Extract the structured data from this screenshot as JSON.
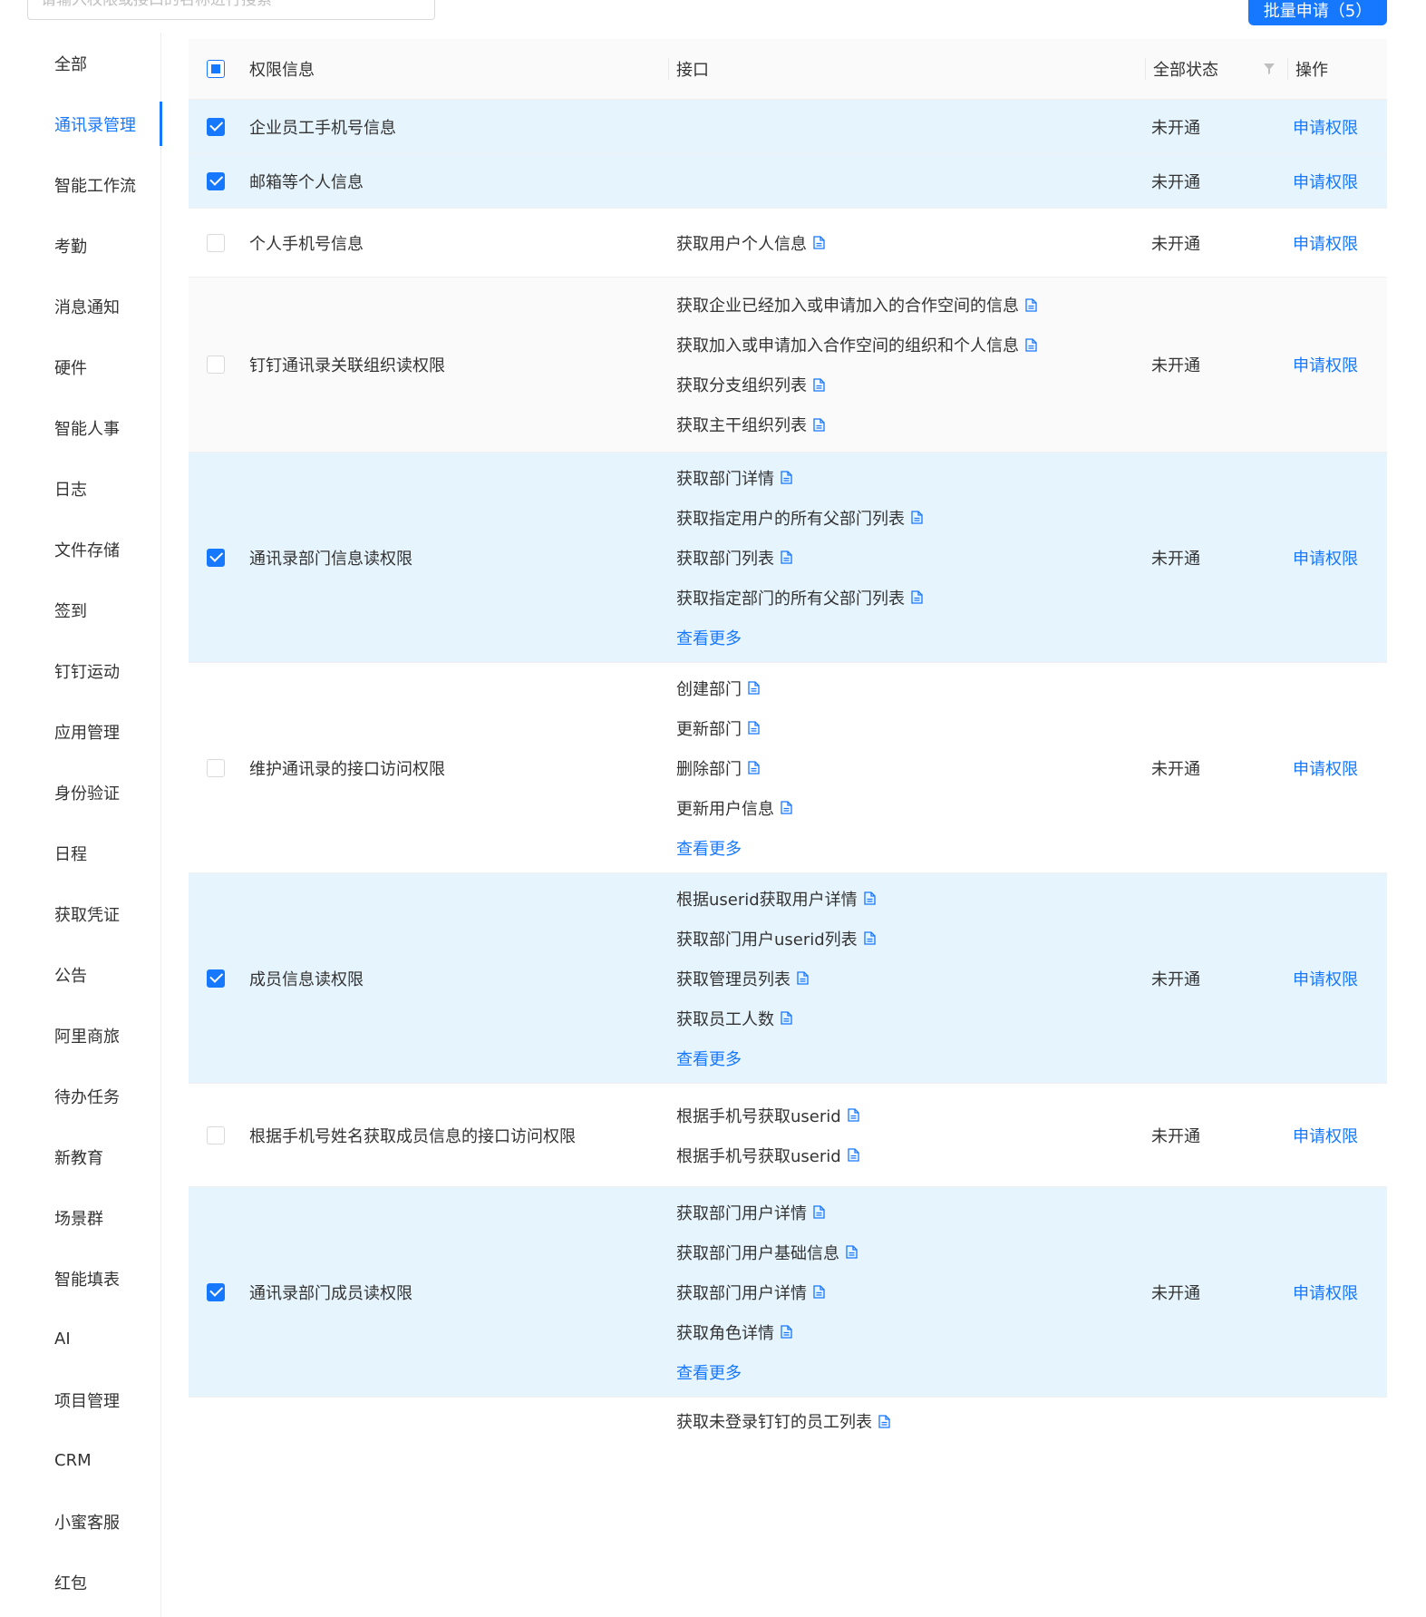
{
  "search": {
    "placeholder": "请输入权限或接口的名称进行搜索"
  },
  "batch_button": {
    "label": "批量申请（5）"
  },
  "sidebar": {
    "items": [
      {
        "label": "全部",
        "active": false
      },
      {
        "label": "通讯录管理",
        "active": true
      },
      {
        "label": "智能工作流",
        "active": false
      },
      {
        "label": "考勤",
        "active": false
      },
      {
        "label": "消息通知",
        "active": false
      },
      {
        "label": "硬件",
        "active": false
      },
      {
        "label": "智能人事",
        "active": false
      },
      {
        "label": "日志",
        "active": false
      },
      {
        "label": "文件存储",
        "active": false
      },
      {
        "label": "签到",
        "active": false
      },
      {
        "label": "钉钉运动",
        "active": false
      },
      {
        "label": "应用管理",
        "active": false
      },
      {
        "label": "身份验证",
        "active": false
      },
      {
        "label": "日程",
        "active": false
      },
      {
        "label": "获取凭证",
        "active": false
      },
      {
        "label": "公告",
        "active": false
      },
      {
        "label": "阿里商旅",
        "active": false
      },
      {
        "label": "待办任务",
        "active": false
      },
      {
        "label": "新教育",
        "active": false
      },
      {
        "label": "场景群",
        "active": false
      },
      {
        "label": "智能填表",
        "active": false
      },
      {
        "label": "AI",
        "active": false
      },
      {
        "label": "项目管理",
        "active": false
      },
      {
        "label": "CRM",
        "active": false
      },
      {
        "label": "小蜜客服",
        "active": false
      },
      {
        "label": "红包",
        "active": false
      }
    ]
  },
  "table": {
    "headers": {
      "perm": "权限信息",
      "api": "接口",
      "status": "全部状态",
      "op": "操作"
    },
    "rows": [
      {
        "name": "企业员工手机号信息",
        "checked": true,
        "apis": [],
        "more": "",
        "status": "未开通",
        "action": "申请权限"
      },
      {
        "name": "邮箱等个人信息",
        "checked": true,
        "apis": [],
        "more": "",
        "status": "未开通",
        "action": "申请权限"
      },
      {
        "name": "个人手机号信息",
        "checked": false,
        "apis": [
          "获取用户个人信息"
        ],
        "more": "",
        "status": "未开通",
        "action": "申请权限"
      },
      {
        "name": "钉钉通讯录关联组织读权限",
        "checked": false,
        "apis": [
          "获取企业已经加入或申请加入的合作空间的信息",
          "获取加入或申请加入合作空间的组织和个人信息",
          "获取分支组织列表",
          "获取主干组织列表"
        ],
        "more": "",
        "status": "未开通",
        "action": "申请权限"
      },
      {
        "name": "通讯录部门信息读权限",
        "checked": true,
        "apis": [
          "获取部门详情",
          "获取指定用户的所有父部门列表",
          "获取部门列表",
          "获取指定部门的所有父部门列表"
        ],
        "more": "查看更多",
        "status": "未开通",
        "action": "申请权限"
      },
      {
        "name": "维护通讯录的接口访问权限",
        "checked": false,
        "apis": [
          "创建部门",
          "更新部门",
          "删除部门",
          "更新用户信息"
        ],
        "more": "查看更多",
        "status": "未开通",
        "action": "申请权限"
      },
      {
        "name": "成员信息读权限",
        "checked": true,
        "apis": [
          "根据userid获取用户详情",
          "获取部门用户userid列表",
          "获取管理员列表",
          "获取员工人数"
        ],
        "more": "查看更多",
        "status": "未开通",
        "action": "申请权限"
      },
      {
        "name": "根据手机号姓名获取成员信息的接口访问权限",
        "checked": false,
        "apis": [
          "根据手机号获取userid",
          "根据手机号获取userid"
        ],
        "more": "",
        "status": "未开通",
        "action": "申请权限"
      },
      {
        "name": "通讯录部门成员读权限",
        "checked": true,
        "apis": [
          "获取部门用户详情",
          "获取部门用户基础信息",
          "获取部门用户详情",
          "获取角色详情"
        ],
        "more": "查看更多",
        "status": "未开通",
        "action": "申请权限"
      },
      {
        "name": "",
        "checked": false,
        "apis": [
          "获取未登录钉钉的员工列表"
        ],
        "more": "",
        "status": "",
        "action": ""
      }
    ]
  },
  "colors": {
    "accent": "#1677ff",
    "selected_row": "#e6f4fd",
    "header_bg": "#fafafa"
  },
  "icons": {
    "doc": "document-icon",
    "filter": "filter-icon"
  }
}
